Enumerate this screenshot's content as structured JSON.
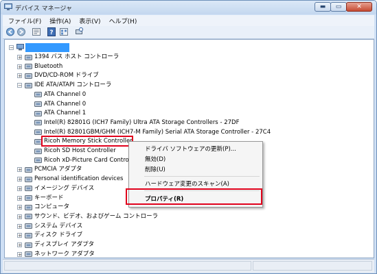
{
  "window": {
    "title": "デバイス マネージャ",
    "minimize_label": "▬",
    "maximize_label": "▭",
    "close_label": "✕"
  },
  "menu": [
    "ファイル(F)",
    "操作(A)",
    "表示(V)",
    "ヘルプ(H)"
  ],
  "toolbar": {
    "buttons": [
      "back-icon",
      "forward-icon",
      "properties-icon",
      "help-icon",
      "view-icon",
      "scan-icon"
    ]
  },
  "tree": {
    "root": "",
    "items": [
      {
        "label": "1394 バス ホスト コントローラ",
        "level": 1,
        "expander": "+"
      },
      {
        "label": "Bluetooth",
        "level": 1,
        "expander": "+"
      },
      {
        "label": "DVD/CD-ROM ドライブ",
        "level": 1,
        "expander": "+"
      },
      {
        "label": "IDE ATA/ATAPI コントローラ",
        "level": 1,
        "expander": "−"
      },
      {
        "label": "ATA Channel 0",
        "level": 2,
        "expander": ""
      },
      {
        "label": "ATA Channel 0",
        "level": 2,
        "expander": ""
      },
      {
        "label": "ATA Channel 1",
        "level": 2,
        "expander": ""
      },
      {
        "label": "Intel(R) 82801G (ICH7 Family) Ultra ATA Storage Controllers - 27DF",
        "level": 2,
        "expander": ""
      },
      {
        "label": "Intel(R) 82801GBM/GHM (ICH7-M Family) Serial ATA Storage Controller - 27C4",
        "level": 2,
        "expander": ""
      },
      {
        "label": "Ricoh Memory Stick Controller",
        "level": 2,
        "expander": ""
      },
      {
        "label": "Ricoh SD Host Controller",
        "level": 2,
        "expander": ""
      },
      {
        "label": "Ricoh xD-Picture Card Controller",
        "level": 2,
        "expander": ""
      },
      {
        "label": "PCMCIA アダプタ",
        "level": 1,
        "expander": "+"
      },
      {
        "label": "Personal identification devices",
        "level": 1,
        "expander": "+"
      },
      {
        "label": "イメージング デバイス",
        "level": 1,
        "expander": "+"
      },
      {
        "label": "キーボード",
        "level": 1,
        "expander": "+"
      },
      {
        "label": "コンピュータ",
        "level": 1,
        "expander": "+"
      },
      {
        "label": "サウンド、ビデオ、およびゲーム コントローラ",
        "level": 1,
        "expander": "+"
      },
      {
        "label": "システム デバイス",
        "level": 1,
        "expander": "+"
      },
      {
        "label": "ディスク ドライブ",
        "level": 1,
        "expander": "+"
      },
      {
        "label": "ディスプレイ アダプタ",
        "level": 1,
        "expander": "+"
      },
      {
        "label": "ネットワーク アダプタ",
        "level": 1,
        "expander": "+"
      }
    ]
  },
  "context_menu": {
    "items": [
      "ドライバ ソフトウェアの更新(P)...",
      "無効(D)",
      "削除(U)",
      "ハードウェア変更のスキャン(A)",
      "プロパティ(R)"
    ]
  },
  "colors": {
    "highlight": "#e0001b",
    "selection": "#3399ff"
  }
}
